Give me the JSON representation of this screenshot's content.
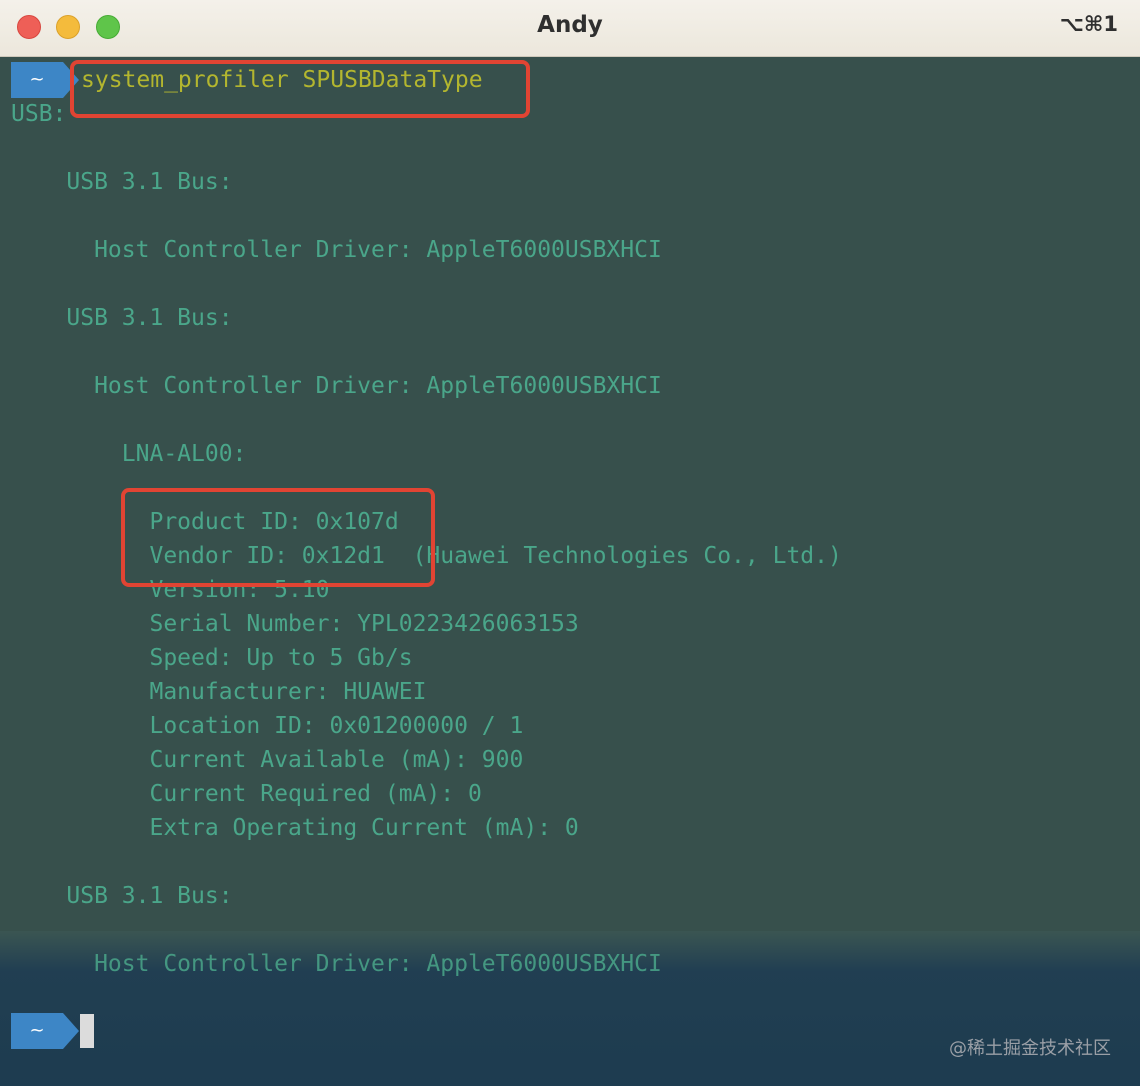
{
  "window": {
    "title": "Andy",
    "shortcut": "⌥⌘1"
  },
  "prompt": {
    "symbol": "~",
    "command": "system_profiler SPUSBDataType"
  },
  "output": [
    "USB:",
    "    USB 3.1 Bus:",
    "      Host Controller Driver: AppleT6000USBXHCI",
    "    USB 3.1 Bus:",
    "      Host Controller Driver: AppleT6000USBXHCI",
    "        LNA-AL00:",
    "          Product ID: 0x107d",
    "          Vendor ID: 0x12d1  (Huawei Technologies Co., Ltd.)",
    "          Version: 5.10",
    "          Serial Number: YPL0223426063153",
    "          Speed: Up to 5 Gb/s",
    "          Manufacturer: HUAWEI",
    "          Location ID: 0x01200000 / 1",
    "          Current Available (mA): 900",
    "          Current Required (mA): 0",
    "          Extra Operating Current (mA): 0",
    "    USB 3.1 Bus:",
    "      Host Controller Driver: AppleT6000USBXHCI"
  ],
  "watermark": "@稀土掘金技术社区",
  "colors": {
    "background": "#37504c",
    "output_text": "#4aa68a",
    "command_text": "#b3b62f",
    "prompt_badge": "#3d86c6",
    "highlight": "#e14433"
  }
}
